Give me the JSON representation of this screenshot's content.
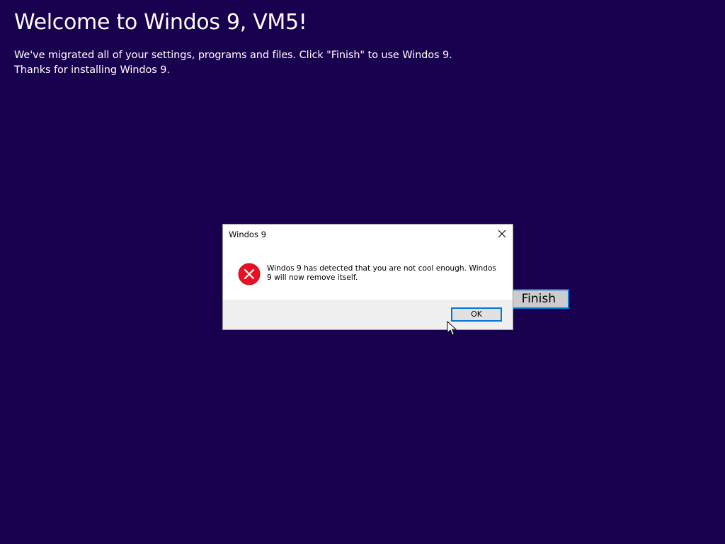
{
  "welcome": {
    "title": "Welcome to Windos 9, VM5!",
    "line1": "We've migrated all of your settings, programs and files. Click \"Finish\" to use Windos 9.",
    "line2": "Thanks for installing Windos 9."
  },
  "finish_button": {
    "label": "Finish"
  },
  "dialog": {
    "title": "Windos 9",
    "message": "Windos 9 has detected that you are not cool enough. Windos 9 will now remove itself.",
    "ok_label": "OK",
    "icon": "error-icon",
    "close_icon": "close-icon"
  },
  "colors": {
    "background": "#18004f",
    "accent": "#0078d7",
    "error": "#e81123"
  }
}
